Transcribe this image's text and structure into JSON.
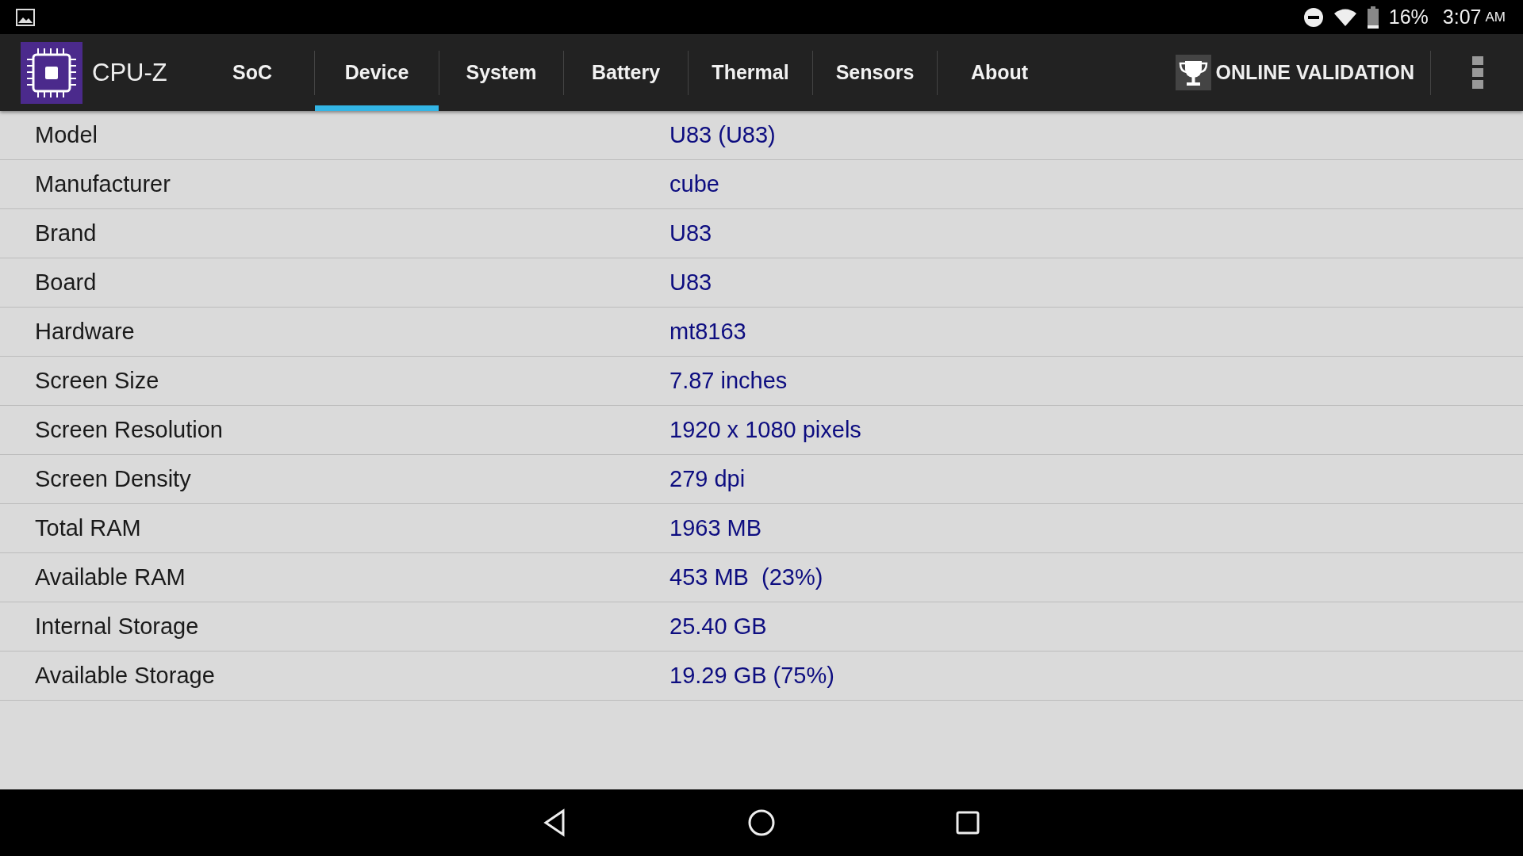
{
  "status_bar": {
    "battery": "16%",
    "time": "3:07",
    "meridiem": "AM"
  },
  "app_bar": {
    "title": "CPU-Z",
    "validation_button": "ONLINE VALIDATION"
  },
  "tabs": [
    {
      "label": "SoC",
      "selected": false
    },
    {
      "label": "Device",
      "selected": true
    },
    {
      "label": "System",
      "selected": false
    },
    {
      "label": "Battery",
      "selected": false
    },
    {
      "label": "Thermal",
      "selected": false
    },
    {
      "label": "Sensors",
      "selected": false
    },
    {
      "label": "About",
      "selected": false
    }
  ],
  "rows": [
    {
      "label": "Model",
      "value": "U83 (U83)"
    },
    {
      "label": "Manufacturer",
      "value": "cube"
    },
    {
      "label": "Brand",
      "value": "U83"
    },
    {
      "label": "Board",
      "value": "U83"
    },
    {
      "label": "Hardware",
      "value": "mt8163"
    },
    {
      "label": "Screen Size",
      "value": "7.87 inches"
    },
    {
      "label": "Screen Resolution",
      "value": "1920 x 1080 pixels"
    },
    {
      "label": "Screen Density",
      "value": "279 dpi"
    },
    {
      "label": "Total RAM",
      "value": "1963 MB"
    },
    {
      "label": "Available RAM",
      "value": "453 MB  (23%)"
    },
    {
      "label": "Internal Storage",
      "value": "25.40 GB"
    },
    {
      "label": "Available Storage",
      "value": "19.29 GB (75%)"
    }
  ]
}
